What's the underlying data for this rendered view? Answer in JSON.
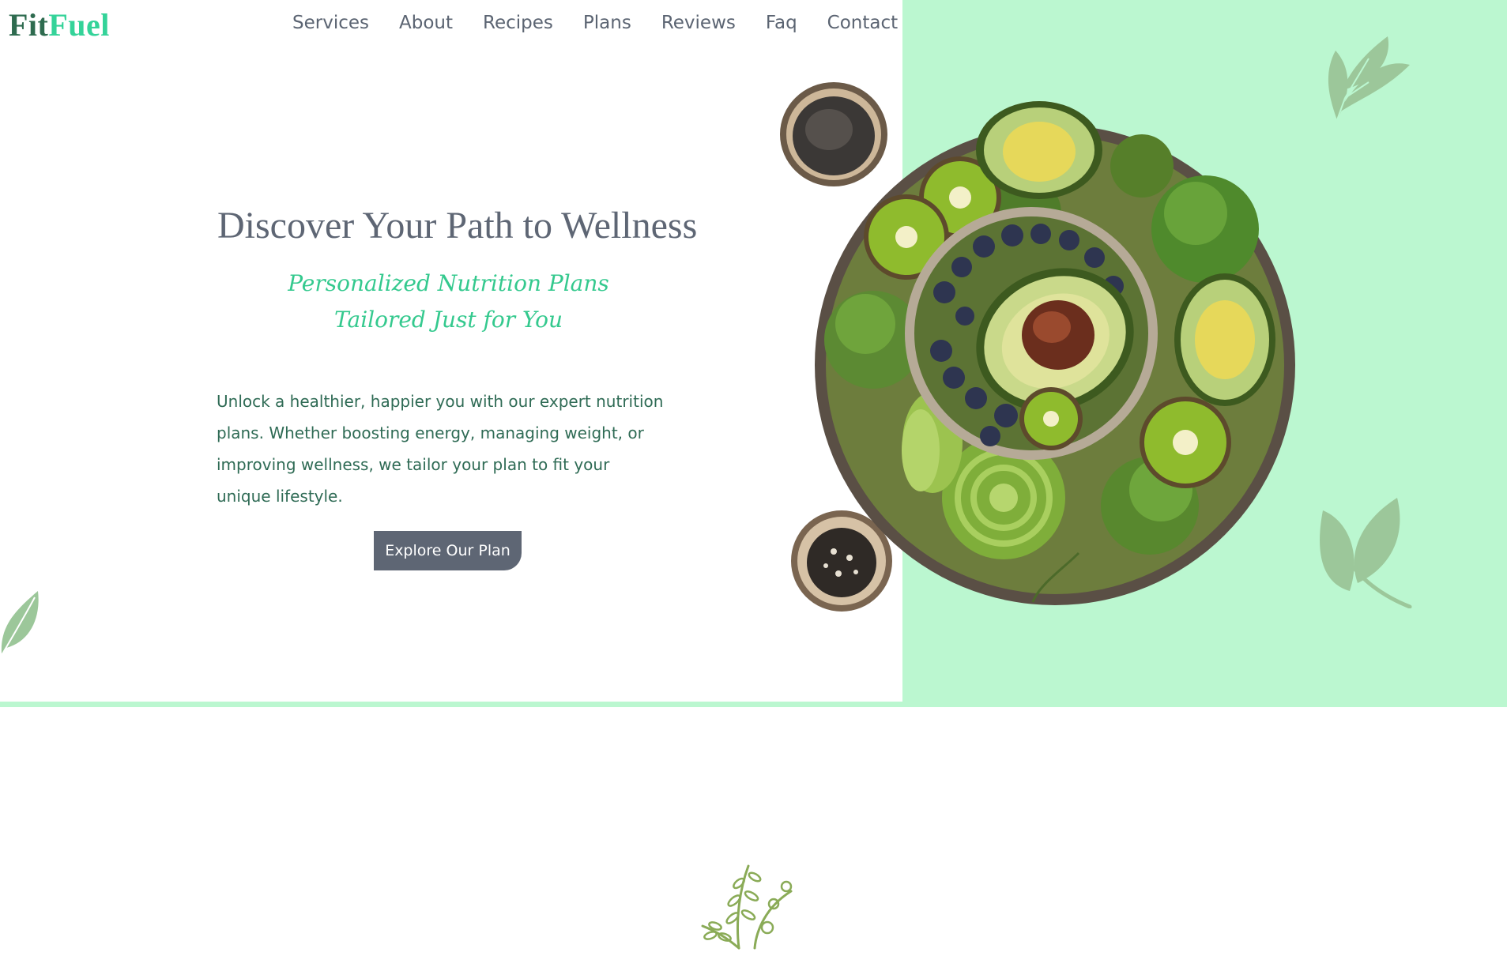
{
  "brand": {
    "part1": "Fit",
    "part2": "Fuel"
  },
  "nav": {
    "items": [
      {
        "label": "Services"
      },
      {
        "label": "About"
      },
      {
        "label": "Recipes"
      },
      {
        "label": "Plans"
      },
      {
        "label": "Reviews"
      },
      {
        "label": "Faq"
      },
      {
        "label": "Contact"
      }
    ]
  },
  "hero": {
    "title": "Discover Your Path to Wellness",
    "subtitle_line1": "Personalized Nutrition Plans",
    "subtitle_line2": "Tailored Just for You",
    "body": "Unlock a healthier, happier you with our expert nutrition plans. Whether boosting energy, managing weight, or improving wellness, we tailor your plan to fit your unique lifestyle.",
    "cta_label": "Explore Our Plan"
  },
  "colors": {
    "accent_mint": "#bbf7d0",
    "brand_dark_green": "#2e6b4f",
    "brand_light_green": "#34d399",
    "slate": "#5e6674",
    "leaf_green": "#9cc79a"
  },
  "icons": [
    "leaf-sprig-icon",
    "leaf-icon",
    "leaf-corner-icon",
    "herb-sprig-icon"
  ]
}
